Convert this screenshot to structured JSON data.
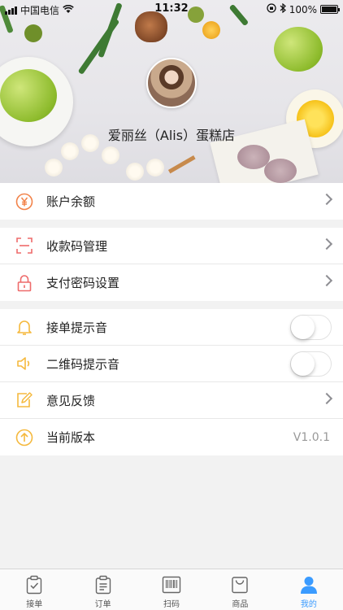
{
  "status_bar": {
    "carrier": "中国电信",
    "time": "11:32",
    "battery": "100%"
  },
  "profile": {
    "shop_name": "爱丽丝（Alis）蛋糕店"
  },
  "groups": [
    {
      "rows": [
        {
          "label": "账户余额",
          "icon": "yuan-icon",
          "accessory": "chevron"
        }
      ]
    },
    {
      "rows": [
        {
          "label": "收款码管理",
          "icon": "scan-frame-icon",
          "accessory": "chevron"
        },
        {
          "label": "支付密码设置",
          "icon": "lock-icon",
          "accessory": "chevron"
        }
      ]
    },
    {
      "rows": [
        {
          "label": "接单提示音",
          "icon": "bell-icon",
          "accessory": "toggle",
          "toggle_on": false
        },
        {
          "label": "二维码提示音",
          "icon": "speaker-icon",
          "accessory": "toggle",
          "toggle_on": false
        },
        {
          "label": "意见反馈",
          "icon": "edit-icon",
          "accessory": "chevron"
        },
        {
          "label": "当前版本",
          "icon": "upload-circle-icon",
          "accessory": "value",
          "value": "V1.0.1"
        }
      ]
    }
  ],
  "tabbar": {
    "active_color": "#3a9bff",
    "items": [
      {
        "label": "接单",
        "icon": "clipboard-check-icon",
        "active": false
      },
      {
        "label": "订单",
        "icon": "clipboard-list-icon",
        "active": false
      },
      {
        "label": "扫码",
        "icon": "barcode-icon",
        "active": false
      },
      {
        "label": "商品",
        "icon": "shopping-bag-icon",
        "active": false
      },
      {
        "label": "我的",
        "icon": "person-icon",
        "active": true
      }
    ]
  }
}
